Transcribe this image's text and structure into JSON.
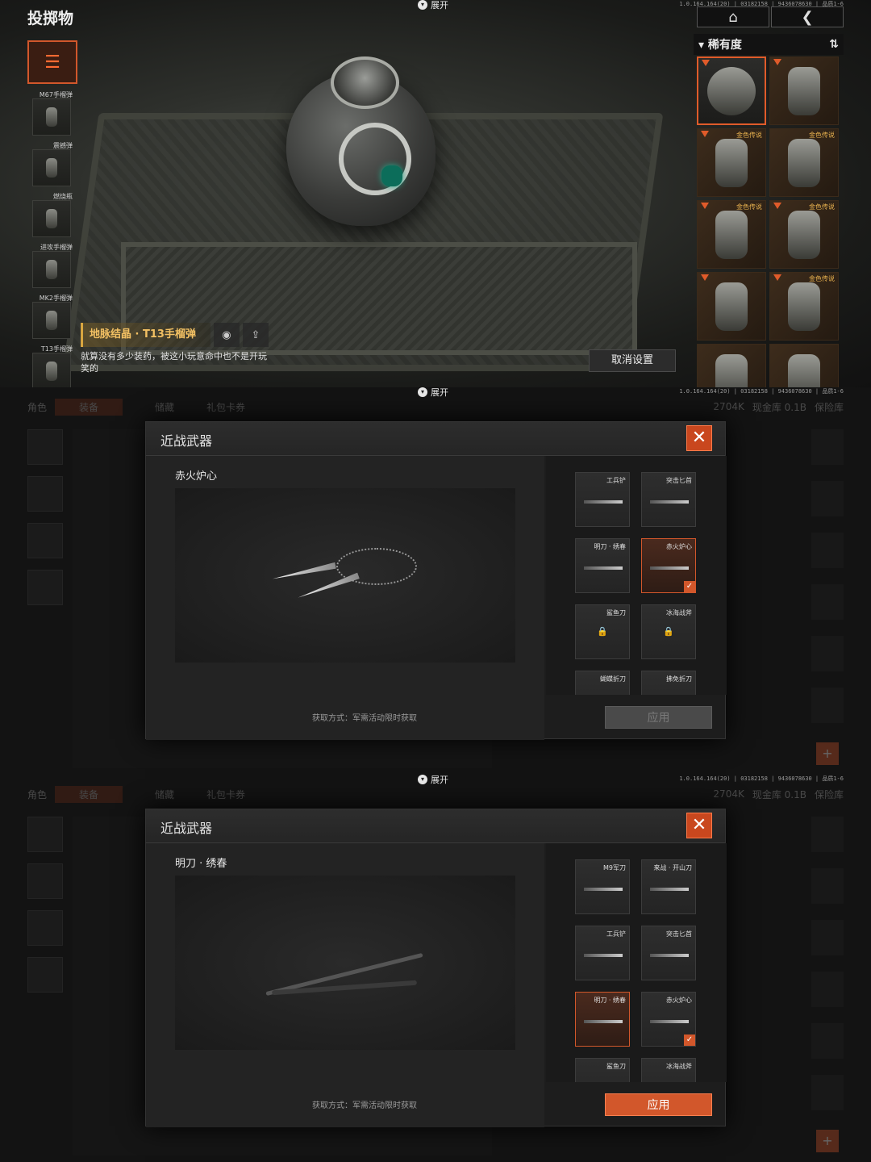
{
  "panel1": {
    "title": "投掷物",
    "expand_label": "展开",
    "version_text": "1.0.164.164(20) | 03182158 | 9436078630 | 品质1-6",
    "side_items": [
      {
        "label": "M67手榴弹"
      },
      {
        "label": "震撼弹"
      },
      {
        "label": "燃烧瓶"
      },
      {
        "label": "进攻手榴弹"
      },
      {
        "label": "MK2手榴弹"
      },
      {
        "label": "T13手榴弹"
      }
    ],
    "selected_name": "地脉结晶 · T13手榴弹",
    "description": "就算没有多少装药，被这小玩意命中也不是开玩笑的",
    "cancel_label": "取消设置",
    "sort_label": "稀有度",
    "grid_tags": [
      "",
      "",
      "金色传说",
      "金色传说",
      "金色传说",
      "金色传说",
      "",
      "金色传说",
      "",
      ""
    ]
  },
  "background": {
    "tabs": [
      "角色",
      "装备",
      "储藏",
      "礼包卡券"
    ],
    "stats": [
      "2704K",
      "现金库 0.1B",
      "保险库"
    ]
  },
  "panel2": {
    "expand_label": "展开",
    "version_text": "1.0.164.164(20) | 03182158 | 9436078630 | 品质1-6",
    "dialog_title": "近战武器",
    "weapon_name": "赤火炉心",
    "source_text": "获取方式：军需活动限时获取",
    "apply_label": "应用",
    "weapons": [
      {
        "name": "工兵铲"
      },
      {
        "name": "突击匕首"
      },
      {
        "name": "明刀 · 绣春"
      },
      {
        "name": "赤火炉心"
      },
      {
        "name": "鲨鱼刀"
      },
      {
        "name": "冰海战斧"
      },
      {
        "name": "蝴蝶折刀"
      },
      {
        "name": "拂免折刀"
      }
    ]
  },
  "panel3": {
    "expand_label": "展开",
    "version_text": "1.0.164.164(20) | 03182158 | 9436078630 | 品质1-6",
    "dialog_title": "近战武器",
    "weapon_name": "明刀 · 绣春",
    "source_text": "获取方式：军需活动限时获取",
    "apply_label": "应用",
    "weapons": [
      {
        "name": "M9军刀"
      },
      {
        "name": "来战 · 开山刀"
      },
      {
        "name": "工兵铲"
      },
      {
        "name": "突击匕首"
      },
      {
        "name": "明刀 · 绣春"
      },
      {
        "name": "赤火炉心"
      },
      {
        "name": "鲨鱼刀"
      },
      {
        "name": "冰海战斧"
      }
    ]
  }
}
